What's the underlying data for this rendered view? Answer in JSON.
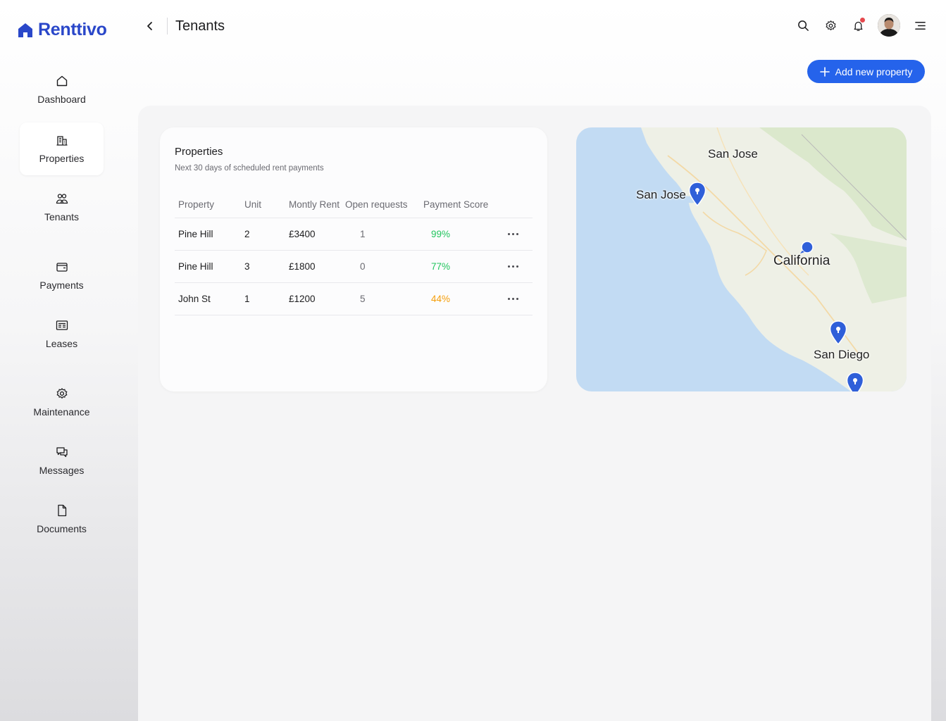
{
  "app": {
    "name": "Renttivo"
  },
  "header": {
    "title": "Tenants"
  },
  "sidebar": {
    "items": [
      {
        "label": "Dashboard",
        "icon": "home-icon"
      },
      {
        "label": "Properties",
        "icon": "building-icon",
        "active": true
      },
      {
        "label": "Tenants",
        "icon": "users-icon"
      },
      {
        "label": "Payments",
        "icon": "wallet-icon"
      },
      {
        "label": "Leases",
        "icon": "lease-icon"
      },
      {
        "label": "Maintenance",
        "icon": "gear-icon"
      },
      {
        "label": "Messages",
        "icon": "messages-icon"
      },
      {
        "label": "Documents",
        "icon": "document-icon"
      }
    ]
  },
  "actions": {
    "add_property": "Add new property"
  },
  "properties_card": {
    "title": "Properties",
    "subtitle": "Next 30 days of scheduled rent payments",
    "columns": [
      "Property",
      "Unit",
      "Montly Rent",
      "Open requests",
      "Payment Score"
    ],
    "rows": [
      {
        "property": "Pine Hill",
        "unit": "2",
        "rent": "£3400",
        "requests": "1",
        "score": "99%"
      },
      {
        "property": "Pine Hill",
        "unit": "3",
        "rent": "£1800",
        "requests": "0",
        "score": "77%"
      },
      {
        "property": "John St",
        "unit": "1",
        "rent": "£1200",
        "requests": "5",
        "score": "44%"
      }
    ]
  },
  "map": {
    "labels": [
      "San Jose",
      "San Jose",
      "California",
      "San Diego"
    ]
  },
  "colors": {
    "brand": "#2a47c9",
    "accent": "#2563eb",
    "score_good": "#22c55e",
    "score_warn": "#f59e0b"
  }
}
